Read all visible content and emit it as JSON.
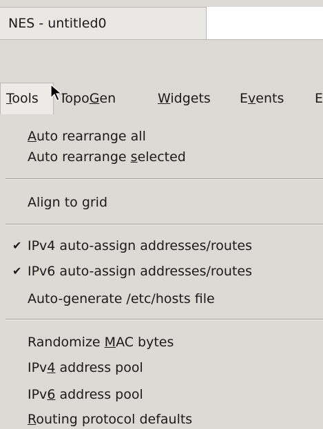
{
  "window": {
    "title": "NES - untitled0"
  },
  "menubar": {
    "items": [
      {
        "pre": "",
        "key": "T",
        "post": "ools"
      },
      {
        "pre": "Topo",
        "key": "G",
        "post": "en"
      },
      {
        "pre": "",
        "key": "W",
        "post": "idgets"
      },
      {
        "pre": "E",
        "key": "v",
        "post": "ents"
      },
      {
        "pre": "",
        "key": "",
        "post": "E"
      }
    ]
  },
  "tools_menu": {
    "auto_rearrange_all": {
      "pre": "",
      "key": "A",
      "post": "uto rearrange all"
    },
    "auto_rearrange_selected": {
      "pre": "Auto rearrange ",
      "key": "s",
      "post": "elected"
    },
    "align_to_grid": {
      "pre": "Align to ",
      "key": "g",
      "post": "rid"
    },
    "ipv4_auto_assign": {
      "label": "IPv4 auto-assign addresses/routes",
      "checked": true
    },
    "ipv6_auto_assign": {
      "label": "IPv6 auto-assign addresses/routes",
      "checked": true
    },
    "auto_generate_hosts": {
      "label": "Auto-generate /etc/hosts file"
    },
    "randomize_mac": {
      "pre": "Randomize ",
      "key": "M",
      "post": "AC bytes"
    },
    "ipv4_pool": {
      "pre": "IPv",
      "key": "4",
      "post": " address pool"
    },
    "ipv6_pool": {
      "pre": "IPv",
      "key": "6",
      "post": " address pool"
    },
    "routing_defaults": {
      "pre": "",
      "key": "R",
      "post": "outing protocol defaults"
    },
    "check_glyph": "✔"
  },
  "icons": {
    "cursor": "arrow-pointer"
  }
}
